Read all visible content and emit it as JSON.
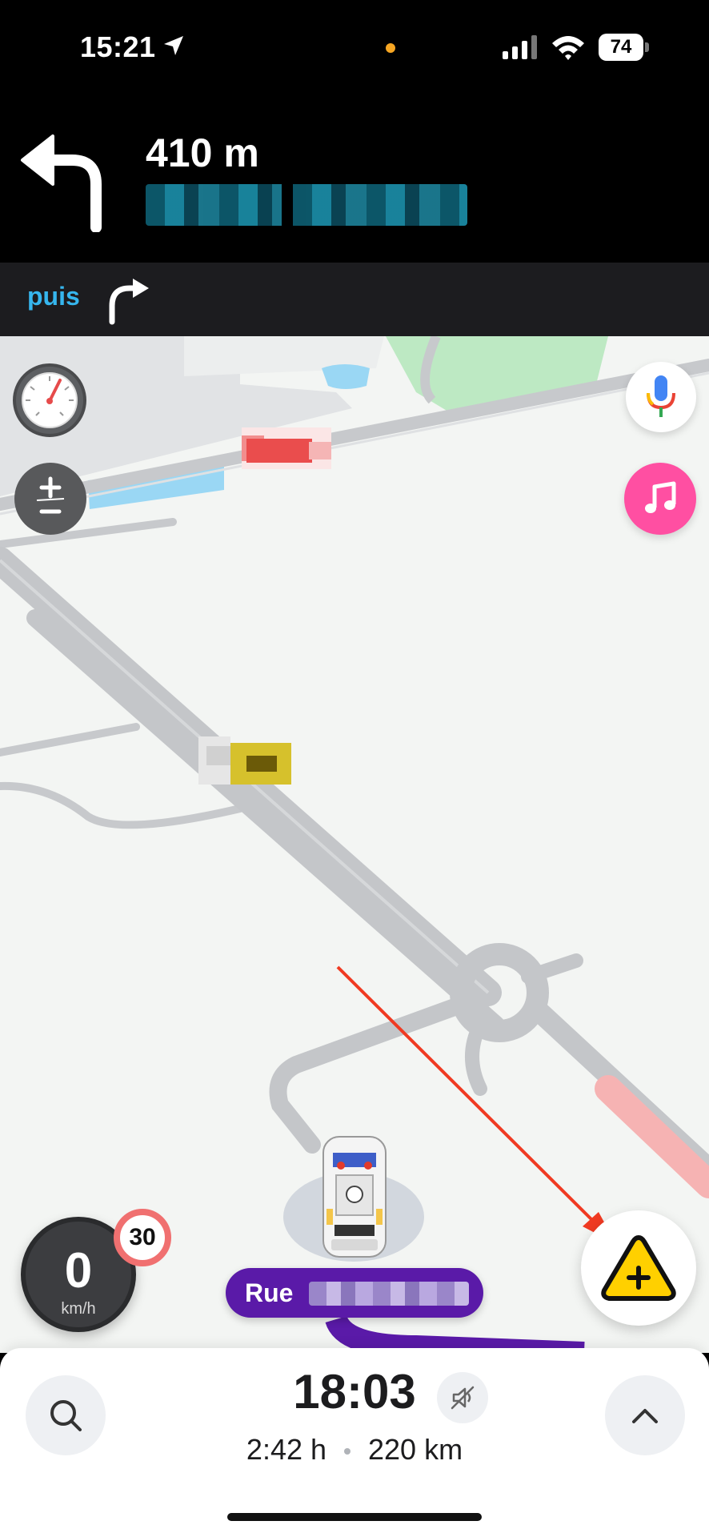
{
  "status_bar": {
    "time": "15:21",
    "battery": "74",
    "colors": {
      "background": "#000000",
      "recording_dot": "#f6a623"
    },
    "icons": [
      "location-arrow-icon",
      "signal-icon",
      "wifi-icon",
      "battery-icon"
    ]
  },
  "instruction": {
    "distance": "410 m",
    "maneuver_icon": "turn-left-icon",
    "street_name_visible": false
  },
  "next_instruction": {
    "label": "puis",
    "maneuver_icon": "turn-right-icon",
    "label_color": "#36b6ee"
  },
  "map": {
    "background_color": "#f3f5f3",
    "controls": {
      "speedometer_icon": "speedometer-icon",
      "zoom_icon": "zoom-plus-minus-icon",
      "voice_icon": "microphone-icon",
      "music_icon": "music-note-icon",
      "music_color": "#ff4fa2"
    },
    "speed": {
      "value": "0",
      "unit": "km/h"
    },
    "speed_limit": "30",
    "current_street": {
      "prefix": "Rue",
      "color": "#5a1aa8"
    },
    "report_icon": "report-hazard-plus-icon",
    "report_color": "#ffd000",
    "annotation_arrow_color": "#f03a22"
  },
  "bottom_sheet": {
    "eta": "18:03",
    "duration": "2:42 h",
    "distance": "220 km",
    "search_icon": "search-icon",
    "mute_icon": "sound-off-icon",
    "expand_icon": "chevron-up-icon"
  }
}
